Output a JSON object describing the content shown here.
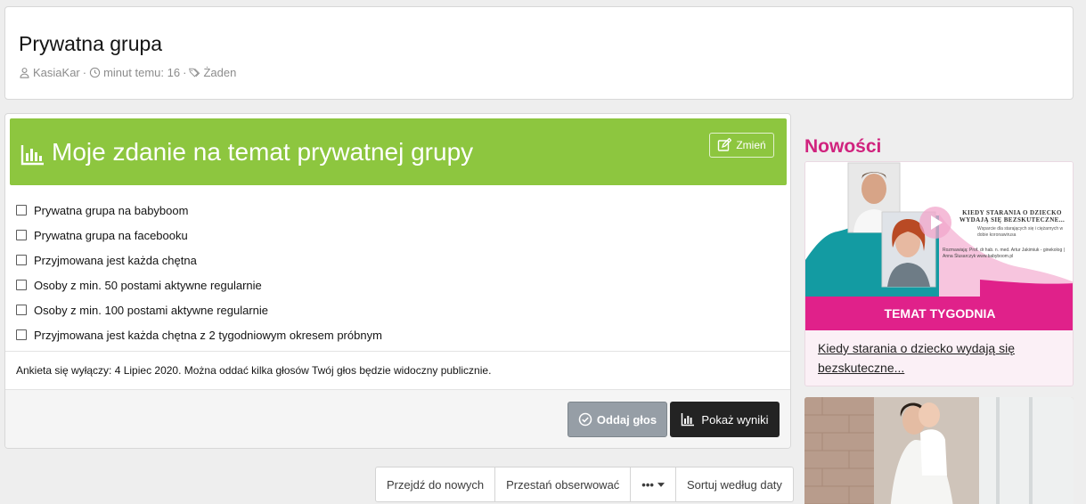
{
  "thread": {
    "title": "Prywatna grupa",
    "author": "KasiaKar",
    "time": "minut temu: 16",
    "tags": "Żaden"
  },
  "poll": {
    "title": "Moje zdanie na temat prywatnej grupy",
    "edit_label": "Zmień",
    "options": [
      "Prywatna grupa na babyboom",
      "Prywatna grupa na facebooku",
      "Przyjmowana jest każda chętna",
      "Osoby z min. 50 postami aktywne regularnie",
      "Osoby z min. 100 postami aktywne regularnie",
      "Przyjmowana jest każda chętna z 2 tygodniowym okresem próbnym"
    ],
    "note": "Ankieta się wyłączy: 4 Lipiec 2020. Można oddać kilka głosów Twój głos będzie widoczny publicznie.",
    "vote_label": "Oddaj głos",
    "results_label": "Pokaż wyniki"
  },
  "thread_actions": {
    "go_new": "Przejdź do nowych",
    "unwatch": "Przestań obserwować",
    "more": "•••",
    "sort": "Sortuj według daty"
  },
  "sidebar": {
    "title": "Nowości",
    "news": {
      "banner": "TEMAT TYGODNIA",
      "link": "Kiedy starania o dziecko wydają się bezskuteczne...",
      "img_title": "KIEDY STARANIA O DZIECKO WYDAJĄ SIĘ BEZSKUTECZNE...",
      "img_sub": "Wsparcie dla starających się i ciężarnych w dobie koronawirusa",
      "img_guests": "Rozmawiają: Prof. dr hab. n. med. Artur Jakimiuk - ginekolog | Anna Ślusarczyk www.babyboom.pl"
    }
  },
  "colors": {
    "poll_header": "#8dc63f",
    "accent_pink": "#e0218a",
    "sidebar_title": "#d0237e",
    "vote_button": "#969ea6",
    "results_button": "#232323"
  }
}
